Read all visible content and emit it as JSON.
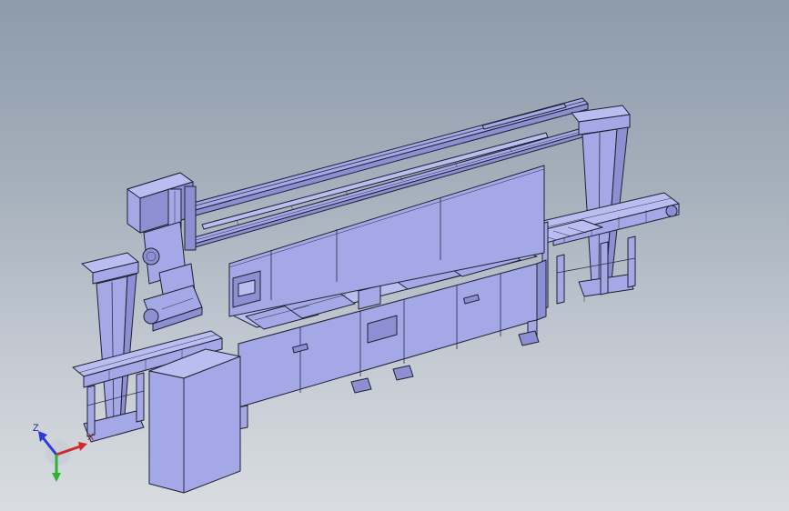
{
  "triad": {
    "z_label": "Z",
    "x_label": "X",
    "x_color": "#d22a2a",
    "y_color": "#2bb52b",
    "z_color": "#2b3bd6"
  },
  "colors": {
    "part_fill": "#a4a8e6",
    "edge": "#1e2030",
    "background_top": "#8d9bab",
    "background_bottom": "#d9dde2"
  }
}
